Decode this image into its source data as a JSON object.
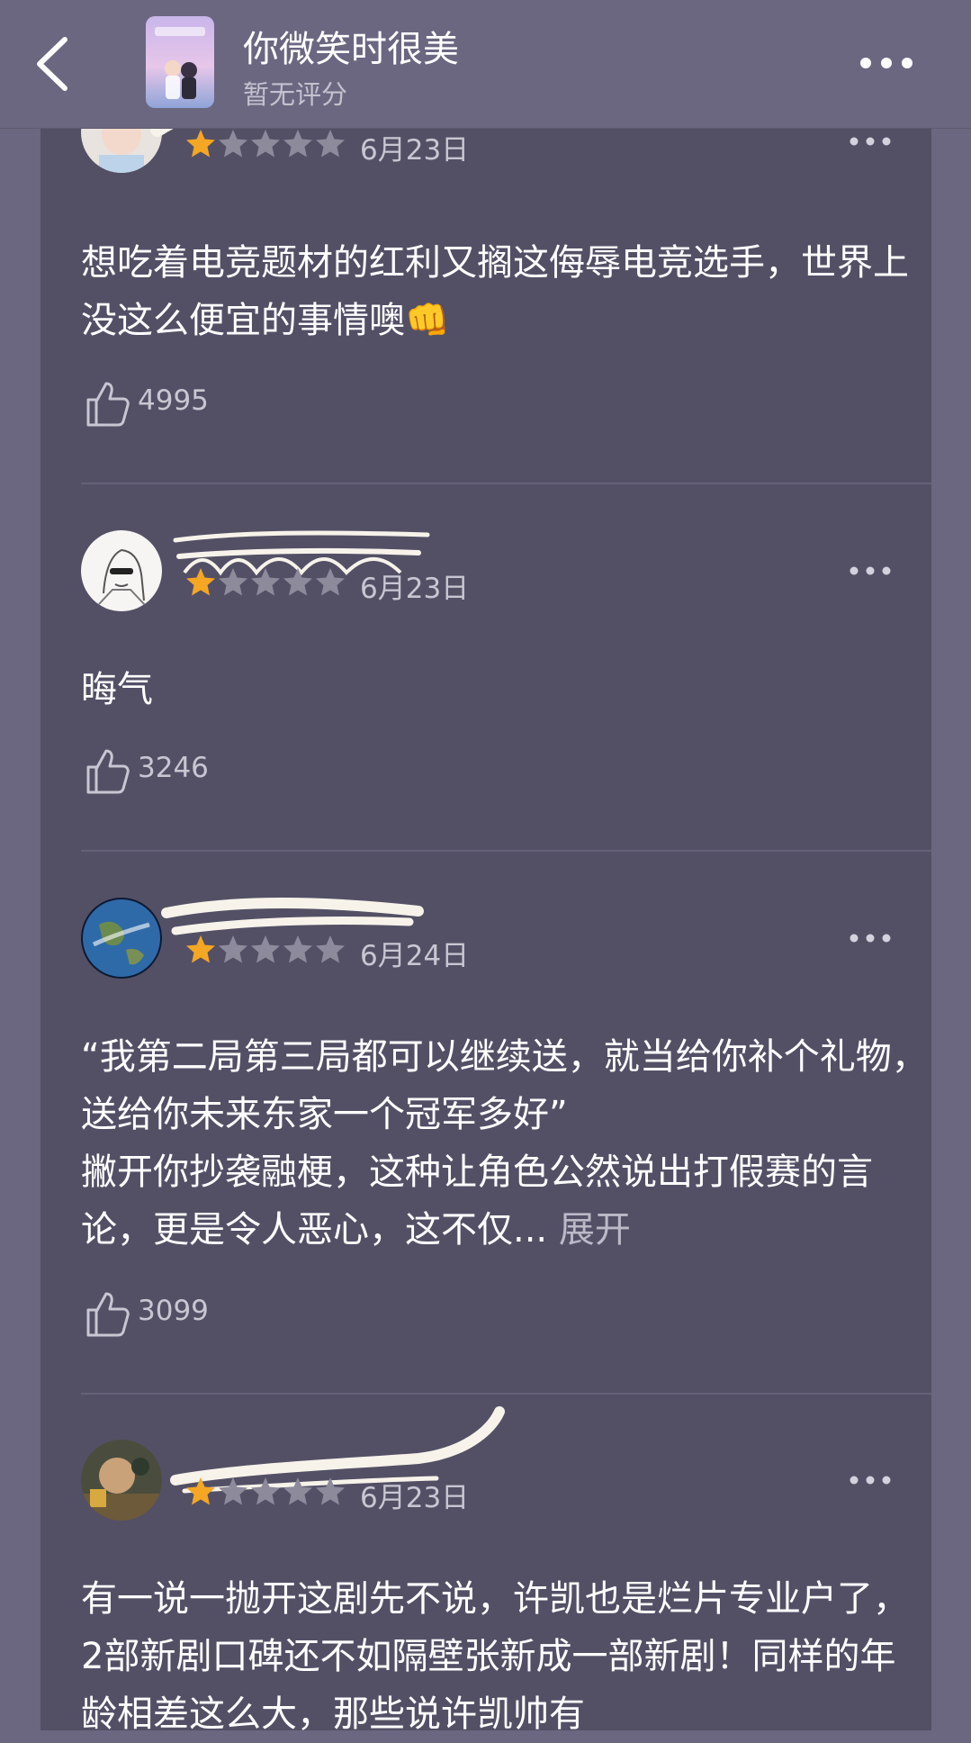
{
  "header": {
    "title": "你微笑时很美",
    "subtitle": "暂无评分"
  },
  "colors": {
    "background": "#6b6781",
    "card": "#535066",
    "star_filled": "#f5a623",
    "star_empty": "#8d8a9c"
  },
  "reviews": [
    {
      "rating": 1,
      "date": "6月23日",
      "text": "想吃着电竞题材的红利又搁这侮辱电竞选手，世界上没这么便宜的事情噢👊",
      "likes": "4995"
    },
    {
      "rating": 1,
      "date": "6月23日",
      "text": "晦气",
      "likes": "3246"
    },
    {
      "rating": 1,
      "date": "6月24日",
      "text": "“我第二局第三局都可以继续送，就当给你补个礼物，送给你未来东家一个冠军多好”\n撇开你抄袭融梗，这种让角色公然说出打假赛的言论，更是令人恶心，这不仅...",
      "expand": "展开",
      "likes": "3099"
    },
    {
      "rating": 1,
      "date": "6月23日",
      "text": "有一说一抛开这剧先不说，许凯也是烂片专业户了，2部新剧口碑还不如隔壁张新成一部新剧！同样的年龄相差这么大，那些说许凯帅有"
    }
  ]
}
